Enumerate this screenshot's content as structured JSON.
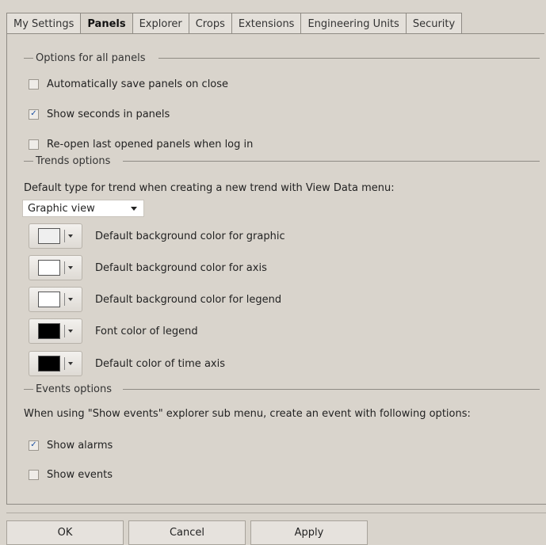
{
  "tabs": [
    {
      "label": "My Settings",
      "active": false
    },
    {
      "label": "Panels",
      "active": true
    },
    {
      "label": "Explorer",
      "active": false
    },
    {
      "label": "Crops",
      "active": false
    },
    {
      "label": "Extensions",
      "active": false
    },
    {
      "label": "Engineering Units",
      "active": false
    },
    {
      "label": "Security",
      "active": false
    }
  ],
  "panels_group": {
    "title": "Options for all panels",
    "options": [
      {
        "label": "Automatically save panels on close",
        "checked": false
      },
      {
        "label": "Show seconds in panels",
        "checked": true
      },
      {
        "label": "Re-open last opened panels when log in",
        "checked": false
      }
    ]
  },
  "trends_group": {
    "title": "Trends options",
    "default_type_label": "Default type for trend when creating a new trend with View Data menu:",
    "default_type_value": "Graphic view",
    "colors": [
      {
        "label": "Default background color for graphic",
        "color": "#efefef"
      },
      {
        "label": "Default background color for axis",
        "color": "#ffffff"
      },
      {
        "label": "Default background color for legend",
        "color": "#ffffff"
      },
      {
        "label": "Font color of legend",
        "color": "#000000"
      },
      {
        "label": "Default color of time axis",
        "color": "#000000"
      }
    ]
  },
  "events_group": {
    "title": "Events options",
    "description": "When using \"Show events\" explorer sub menu, create an event with following options:",
    "options": [
      {
        "label": "Show alarms",
        "checked": true
      },
      {
        "label": "Show events",
        "checked": false
      }
    ]
  },
  "buttons": {
    "ok": "OK",
    "cancel": "Cancel",
    "apply": "Apply"
  },
  "check_glyph": "✓"
}
